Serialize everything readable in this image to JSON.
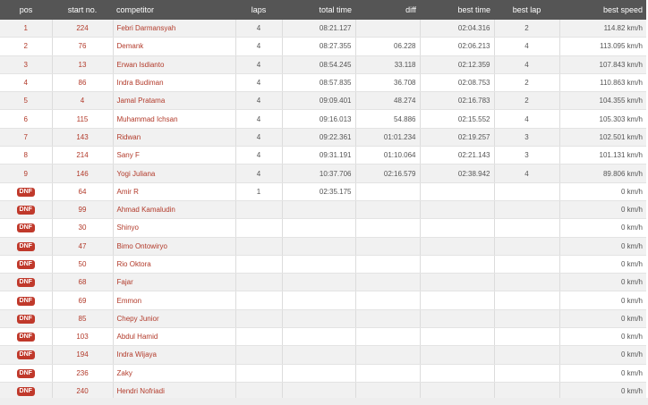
{
  "table": {
    "headers": {
      "pos": "pos",
      "start_no": "start no.",
      "competitor": "competitor",
      "laps": "laps",
      "total_time": "total time",
      "diff": "diff",
      "best_time": "best time",
      "best_lap": "best lap",
      "best_speed": "best speed"
    },
    "rows": [
      {
        "pos": "1",
        "dnf": false,
        "start_no": "224",
        "competitor": "Febri Darmansyah",
        "laps": "4",
        "total_time": "08:21.127",
        "diff": "",
        "best_time": "02:04.316",
        "best_lap": "2",
        "best_speed": "114.82 km/h"
      },
      {
        "pos": "2",
        "dnf": false,
        "start_no": "76",
        "competitor": "Demank",
        "laps": "4",
        "total_time": "08:27.355",
        "diff": "06.228",
        "best_time": "02:06.213",
        "best_lap": "4",
        "best_speed": "113.095 km/h"
      },
      {
        "pos": "3",
        "dnf": false,
        "start_no": "13",
        "competitor": "Erwan Isdianto",
        "laps": "4",
        "total_time": "08:54.245",
        "diff": "33.118",
        "best_time": "02:12.359",
        "best_lap": "4",
        "best_speed": "107.843 km/h"
      },
      {
        "pos": "4",
        "dnf": false,
        "start_no": "86",
        "competitor": "Indra Budiman",
        "laps": "4",
        "total_time": "08:57.835",
        "diff": "36.708",
        "best_time": "02:08.753",
        "best_lap": "2",
        "best_speed": "110.863 km/h"
      },
      {
        "pos": "5",
        "dnf": false,
        "start_no": "4",
        "competitor": "Jamal Pratama",
        "laps": "4",
        "total_time": "09:09.401",
        "diff": "48.274",
        "best_time": "02:16.783",
        "best_lap": "2",
        "best_speed": "104.355 km/h"
      },
      {
        "pos": "6",
        "dnf": false,
        "start_no": "115",
        "competitor": "Muhammad Ichsan",
        "laps": "4",
        "total_time": "09:16.013",
        "diff": "54.886",
        "best_time": "02:15.552",
        "best_lap": "4",
        "best_speed": "105.303 km/h"
      },
      {
        "pos": "7",
        "dnf": false,
        "start_no": "143",
        "competitor": "Ridwan",
        "laps": "4",
        "total_time": "09:22.361",
        "diff": "01:01.234",
        "best_time": "02:19.257",
        "best_lap": "3",
        "best_speed": "102.501 km/h"
      },
      {
        "pos": "8",
        "dnf": false,
        "start_no": "214",
        "competitor": "Sany F",
        "laps": "4",
        "total_time": "09:31.191",
        "diff": "01:10.064",
        "best_time": "02:21.143",
        "best_lap": "3",
        "best_speed": "101.131 km/h"
      },
      {
        "pos": "9",
        "dnf": false,
        "start_no": "146",
        "competitor": "Yogi Juliana",
        "laps": "4",
        "total_time": "10:37.706",
        "diff": "02:16.579",
        "best_time": "02:38.942",
        "best_lap": "4",
        "best_speed": "89.806 km/h"
      },
      {
        "pos": "DNF",
        "dnf": true,
        "start_no": "64",
        "competitor": "Amir R",
        "laps": "1",
        "total_time": "02:35.175",
        "diff": "",
        "best_time": "",
        "best_lap": "",
        "best_speed": "0 km/h"
      },
      {
        "pos": "DNF",
        "dnf": true,
        "start_no": "99",
        "competitor": "Ahmad Kamaludin",
        "laps": "",
        "total_time": "",
        "diff": "",
        "best_time": "",
        "best_lap": "",
        "best_speed": "0 km/h"
      },
      {
        "pos": "DNF",
        "dnf": true,
        "start_no": "30",
        "competitor": "Shinyo",
        "laps": "",
        "total_time": "",
        "diff": "",
        "best_time": "",
        "best_lap": "",
        "best_speed": "0 km/h"
      },
      {
        "pos": "DNF",
        "dnf": true,
        "start_no": "47",
        "competitor": "Bimo Ontowiryo",
        "laps": "",
        "total_time": "",
        "diff": "",
        "best_time": "",
        "best_lap": "",
        "best_speed": "0 km/h"
      },
      {
        "pos": "DNF",
        "dnf": true,
        "start_no": "50",
        "competitor": "Rio Oktora",
        "laps": "",
        "total_time": "",
        "diff": "",
        "best_time": "",
        "best_lap": "",
        "best_speed": "0 km/h"
      },
      {
        "pos": "DNF",
        "dnf": true,
        "start_no": "68",
        "competitor": "Fajar",
        "laps": "",
        "total_time": "",
        "diff": "",
        "best_time": "",
        "best_lap": "",
        "best_speed": "0 km/h"
      },
      {
        "pos": "DNF",
        "dnf": true,
        "start_no": "69",
        "competitor": "Emmon",
        "laps": "",
        "total_time": "",
        "diff": "",
        "best_time": "",
        "best_lap": "",
        "best_speed": "0 km/h"
      },
      {
        "pos": "DNF",
        "dnf": true,
        "start_no": "85",
        "competitor": "Chepy Junior",
        "laps": "",
        "total_time": "",
        "diff": "",
        "best_time": "",
        "best_lap": "",
        "best_speed": "0 km/h"
      },
      {
        "pos": "DNF",
        "dnf": true,
        "start_no": "103",
        "competitor": "Abdul Hamid",
        "laps": "",
        "total_time": "",
        "diff": "",
        "best_time": "",
        "best_lap": "",
        "best_speed": "0 km/h"
      },
      {
        "pos": "DNF",
        "dnf": true,
        "start_no": "194",
        "competitor": "Indra Wijaya",
        "laps": "",
        "total_time": "",
        "diff": "",
        "best_time": "",
        "best_lap": "",
        "best_speed": "0 km/h"
      },
      {
        "pos": "DNF",
        "dnf": true,
        "start_no": "236",
        "competitor": "Zaky",
        "laps": "",
        "total_time": "",
        "diff": "",
        "best_time": "",
        "best_lap": "",
        "best_speed": "0 km/h"
      },
      {
        "pos": "DNF",
        "dnf": true,
        "start_no": "240",
        "competitor": "Hendri Nofriadi",
        "laps": "",
        "total_time": "",
        "diff": "",
        "best_time": "",
        "best_lap": "",
        "best_speed": "0 km/h"
      }
    ]
  },
  "colors": {
    "header_bg": "#555555",
    "link_red": "#b23a2a",
    "dnf_badge": "#c0392b",
    "row_alt": "#f1f1f1"
  }
}
